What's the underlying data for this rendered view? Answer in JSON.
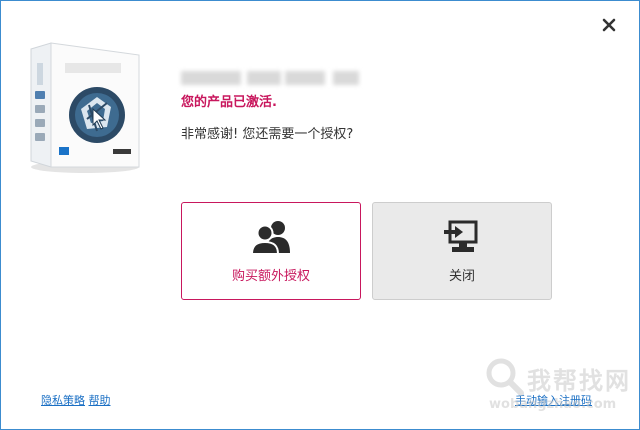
{
  "dialog": {
    "activated_message": "您的产品已激活.",
    "question": "非常感谢! 您还需要一个授权?"
  },
  "options": {
    "buy_label": "购买额外授权",
    "close_label": "关闭"
  },
  "footer": {
    "privacy_label": "隐私策略",
    "help_label": "帮助",
    "manual_register_label": "手动输入注册码"
  },
  "watermark": {
    "title": "我帮找网",
    "url": "wobangzhao.com"
  },
  "colors": {
    "accent": "#c8175d",
    "link": "#1a6fc4",
    "window_border": "#3c8ccf"
  },
  "icons": {
    "close": "close-icon",
    "buy": "users-icon",
    "close_option": "computer-exit-icon"
  }
}
